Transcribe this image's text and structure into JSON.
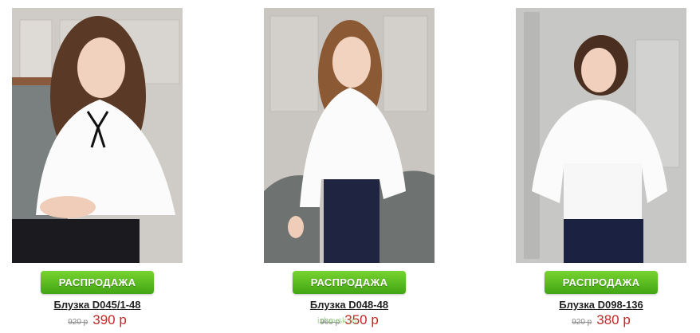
{
  "products": [
    {
      "sale_label": "РАСПРОДАЖА",
      "title": "Блузка D045/1-48",
      "old_price": "920 р",
      "price": "390 р"
    },
    {
      "sale_label": "РАСПРОДАЖА",
      "title": "Блузка D048-48",
      "old_price": "960 р",
      "price": "350 р"
    },
    {
      "sale_label": "РАСПРОДАЖА",
      "title": "Блузка D098-136",
      "old_price": "920 р",
      "price": "380 р"
    }
  ],
  "watermark": "izhevsk.ru",
  "colors": {
    "sale_button": "#4caf1e",
    "price": "#c62828",
    "old_price": "#888888"
  }
}
